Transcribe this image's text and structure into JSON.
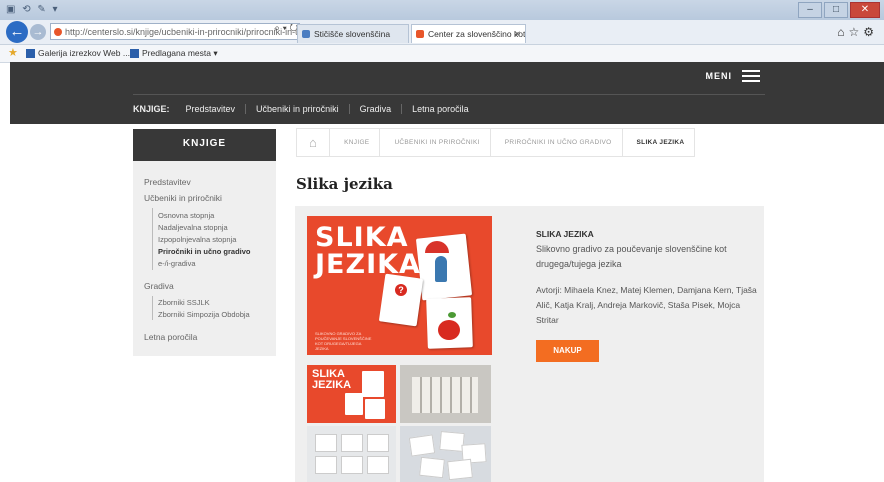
{
  "browser": {
    "address": "http://centerslo.si/knjige/ucbeniki-in-prirocniki/prirocniki-in-uc",
    "address_domain": "centerslo.si",
    "tabs": [
      {
        "label": "Stičišče slovenščina"
      },
      {
        "label": "Center za slovenščino kot dr..."
      }
    ],
    "favorites": [
      {
        "label": "Galerija izrezkov Web ..."
      },
      {
        "label": "Predlagana mesta"
      }
    ]
  },
  "header": {
    "menu_label": "MENI",
    "subnav_label": "KNJIGE:",
    "subnav_items": [
      "Predstavitev",
      "Učbeniki in priročniki",
      "Gradiva",
      "Letna poročila"
    ]
  },
  "sidebar": {
    "title": "KNJIGE",
    "items": [
      {
        "label": "Predstavitev"
      },
      {
        "label": "Učbeniki in priročniki"
      },
      {
        "label": "Gradiva"
      },
      {
        "label": "Letna poročila"
      }
    ],
    "sub_ucbeniki": [
      "Osnovna stopnja",
      "Nadaljevalna stopnja",
      "Izpopolnjevalna stopnja",
      "Priročniki in učno gradivo",
      "e-/i-gradiva"
    ],
    "sub_gradiva": [
      "Zborniki SSJLK",
      "Zborniki Simpozija Obdobja"
    ]
  },
  "breadcrumb": [
    "KNJIGE",
    "UČBENIKI IN PRIROČNIKI",
    "PRIROČNIKI IN UČNO GRADIVO",
    "SLIKA JEZIKA"
  ],
  "page": {
    "title": "Slika jezika"
  },
  "product": {
    "cover_title_line1": "SLIKA",
    "cover_title_line2": "JEZIKA",
    "cover_subtitle": "SLIKOVNO GRADIVO ZA POUČEVANJE SLOVENŠČINE KOT DRUGEGA/TUJEGA JEZIKA",
    "thumb_title_line1": "SLIKA",
    "thumb_title_line2": "JEZIKA",
    "name": "SLIKA JEZIKA",
    "description": "Slikovno gradivo za poučevanje slovenščine kot drugega/tujega jezika",
    "authors": "Avtorji: Mihaela Knez, Matej Klemen, Damjana Kern, Tjaša Alič, Katja Kralj, Andreja Markovič, Staša Pisek, Mojca Stritar",
    "buy_label": "NAKUP"
  },
  "colors": {
    "header_bg": "#383838",
    "accent_orange": "#f36d21",
    "cover_red": "#e8492c"
  }
}
